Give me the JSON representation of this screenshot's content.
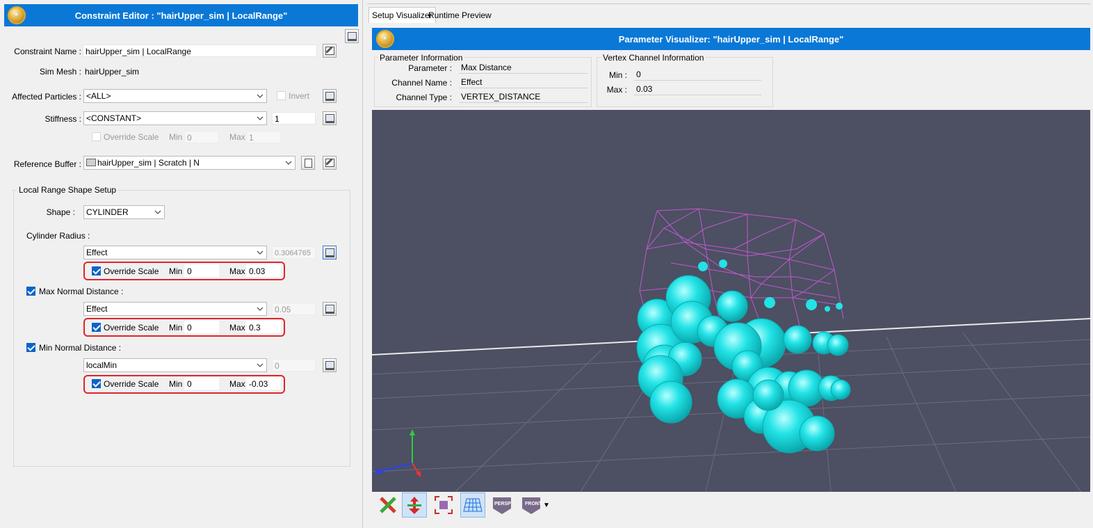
{
  "editor": {
    "title": "Constraint Editor : \"hairUpper_sim | LocalRange\"",
    "constraint_name_label": "Constraint Name :",
    "constraint_name_value": "hairUpper_sim | LocalRange",
    "sim_mesh_label": "Sim Mesh :",
    "sim_mesh_value": "hairUpper_sim",
    "affected_particles_label": "Affected Particles :",
    "affected_particles_value": "<ALL>",
    "invert_label": "Invert",
    "stiffness_label": "Stiffness :",
    "stiffness_value": "<CONSTANT>",
    "stiffness_number": "1",
    "stiffness_override": {
      "label": "Override Scale",
      "min_label": "Min",
      "min": "0",
      "max_label": "Max",
      "max": "1"
    },
    "reference_buffer_label": "Reference Buffer :",
    "reference_buffer_value": "hairUpper_sim | Scratch | N",
    "shape_group_title": "Local Range Shape Setup",
    "shape_label": "Shape :",
    "shape_value": "CYLINDER",
    "cylinder_radius_label": "Cylinder Radius :",
    "cylinder_radius_channel": "Effect",
    "cylinder_radius_number": "0.3064765",
    "cylinder_override": {
      "label": "Override Scale",
      "min_label": "Min",
      "min": "0",
      "max_label": "Max",
      "max": "0.03"
    },
    "max_normal_label": "Max Normal Distance :",
    "max_normal_channel": "Effect",
    "max_normal_number": "0.05",
    "max_normal_override": {
      "label": "Override Scale",
      "min_label": "Min",
      "min": "0",
      "max_label": "Max",
      "max": "0.3"
    },
    "min_normal_label": "Min Normal Distance :",
    "min_normal_channel": "localMin",
    "min_normal_number": "0",
    "min_normal_override": {
      "label": "Override Scale",
      "min_label": "Min",
      "min": "0",
      "max_label": "Max",
      "max": "-0.03"
    }
  },
  "visualizer": {
    "tabs": [
      "Setup Visualizer",
      "Runtime Preview"
    ],
    "title": "Parameter Visualizer: \"hairUpper_sim | LocalRange\"",
    "param_info_title": "Parameter Information",
    "parameter_label": "Parameter :",
    "parameter_value": "Max Distance",
    "channel_name_label": "Channel Name :",
    "channel_name_value": "Effect",
    "channel_type_label": "Channel Type :",
    "channel_type_value": "VERTEX_DISTANCE",
    "vertex_info_title": "Vertex Channel Information",
    "min_label": "Min :",
    "min_value": "0",
    "max_label": "Max :",
    "max_value": "0.03",
    "toolbar": {
      "persp_label": "PERSP",
      "front_label": "FRONT"
    }
  },
  "colors": {
    "title_bar": "#0a78d7",
    "viewport_bg": "#4d4f63",
    "sphere": "#22e3e6",
    "wire": "#cc5ad8",
    "highlight": "#e0242b"
  }
}
